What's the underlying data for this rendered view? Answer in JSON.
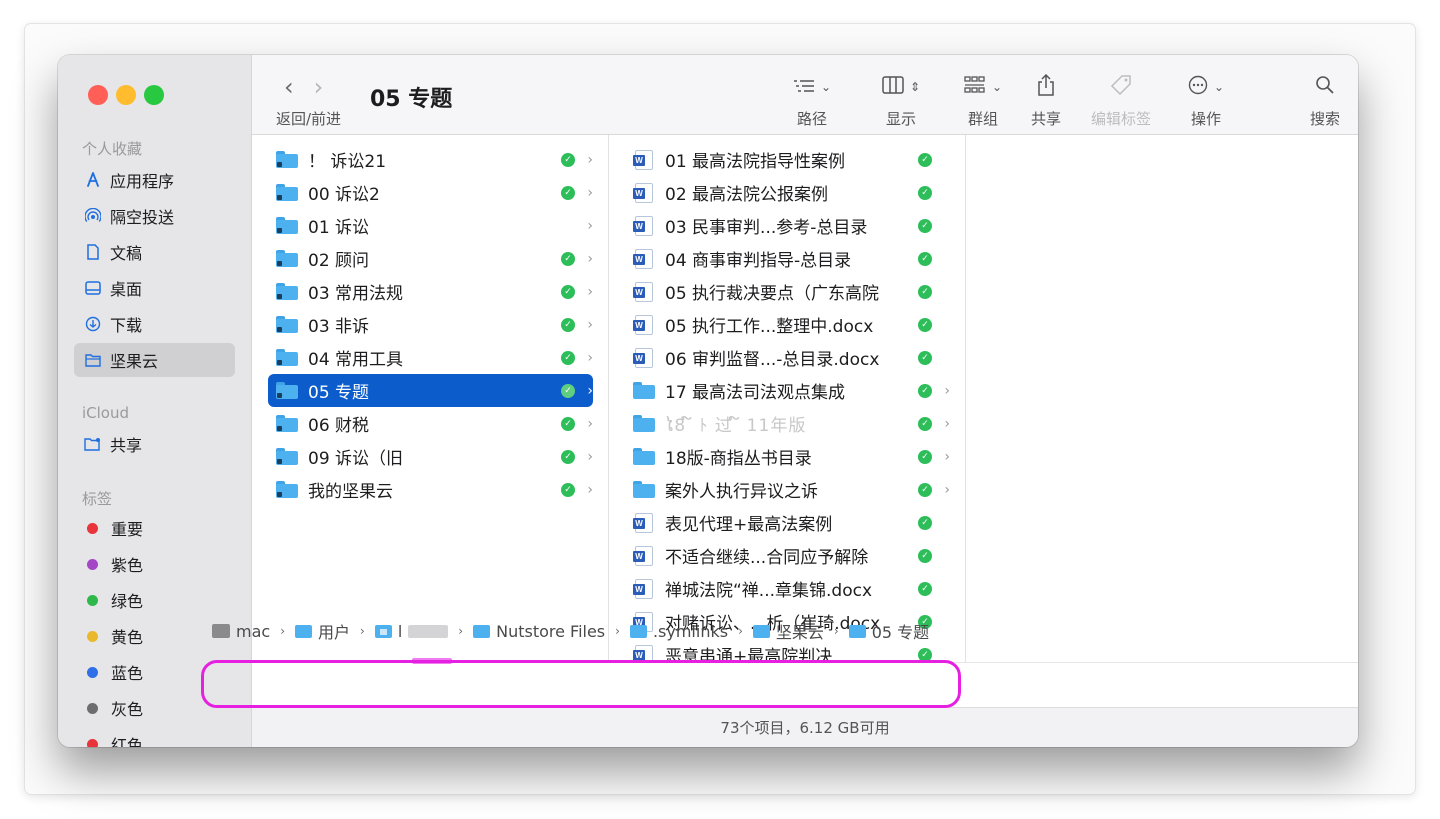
{
  "window": {
    "title": "05 专题",
    "nav_label": "返回/前进"
  },
  "toolbar": {
    "buttons": [
      {
        "label": "路径",
        "icon": "list-view-icon"
      },
      {
        "label": "显示",
        "icon": "column-view-icon"
      },
      {
        "label": "群组",
        "icon": "group-icon"
      },
      {
        "label": "共享",
        "icon": "share-icon"
      },
      {
        "label": "编辑标签",
        "icon": "tag-icon",
        "disabled": true
      },
      {
        "label": "操作",
        "icon": "more-icon"
      },
      {
        "label": "搜索",
        "icon": "search-icon"
      }
    ]
  },
  "sidebar": {
    "favorites_heading": "个人收藏",
    "favorites": [
      {
        "label": "应用程序",
        "icon": "applications-icon"
      },
      {
        "label": "隔空投送",
        "icon": "airdrop-icon"
      },
      {
        "label": "文稿",
        "icon": "document-icon"
      },
      {
        "label": "桌面",
        "icon": "desktop-icon"
      },
      {
        "label": "下载",
        "icon": "download-icon"
      },
      {
        "label": "坚果云",
        "icon": "folder-icon",
        "selected": true
      }
    ],
    "icloud_heading": "iCloud",
    "icloud": [
      {
        "label": "共享",
        "icon": "shared-folder-icon"
      }
    ],
    "tags_heading": "标签",
    "tags": [
      {
        "label": "重要",
        "color": "#e8343a"
      },
      {
        "label": "紫色",
        "color": "#a447c6"
      },
      {
        "label": "绿色",
        "color": "#2fb84a"
      },
      {
        "label": "黄色",
        "color": "#e9b82c"
      },
      {
        "label": "蓝色",
        "color": "#2f6fe8"
      },
      {
        "label": "灰色",
        "color": "#6d6d6f"
      },
      {
        "label": "红色",
        "color": "#e8343a"
      }
    ]
  },
  "column1": [
    {
      "name": "！ 诉讼21",
      "synced": true,
      "arrow": true
    },
    {
      "name": "00 诉讼2",
      "synced": true,
      "arrow": true
    },
    {
      "name": "01 诉讼",
      "synced": false,
      "arrow": true
    },
    {
      "name": "02 顾问",
      "synced": true,
      "arrow": true
    },
    {
      "name": "03 常用法规",
      "synced": true,
      "arrow": true
    },
    {
      "name": "03 非诉",
      "synced": true,
      "arrow": true
    },
    {
      "name": "04 常用工具",
      "synced": true,
      "arrow": true
    },
    {
      "name": "05 专题",
      "synced": true,
      "arrow": true,
      "selected": true
    },
    {
      "name": "06 财税",
      "synced": true,
      "arrow": true
    },
    {
      "name": "09 诉讼（旧",
      "synced": true,
      "arrow": true
    },
    {
      "name": "我的坚果云",
      "synced": true,
      "arrow": true
    }
  ],
  "column2": [
    {
      "name": "01 最高法院指导性案例",
      "type": "doc",
      "synced": true,
      "arrow": false
    },
    {
      "name": "02 最高法院公报案例",
      "type": "doc",
      "synced": true,
      "arrow": false
    },
    {
      "name": "03 民事审判...参考-总目录",
      "type": "doc",
      "synced": true,
      "arrow": false
    },
    {
      "name": "04 商事审判指导-总目录",
      "type": "doc",
      "synced": true,
      "arrow": false
    },
    {
      "name": "05 执行裁决要点（广东高院",
      "type": "doc",
      "synced": true,
      "arrow": false
    },
    {
      "name": "05 执行工作...整理中.docx",
      "type": "doc",
      "synced": true,
      "arrow": false
    },
    {
      "name": "06 审判监督...-总目录.docx",
      "type": "doc",
      "synced": true,
      "arrow": false
    },
    {
      "name": "17 最高法司法观点集成",
      "type": "folder",
      "synced": true,
      "arrow": true
    },
    {
      "name": "ໄ8 ໌ ﾄ 过 ໌ 11年版",
      "type": "folder",
      "synced": true,
      "arrow": true,
      "obscured": true
    },
    {
      "name": "18版-商指丛书目录",
      "type": "folder",
      "synced": true,
      "arrow": true
    },
    {
      "name": "案外人执行异议之诉",
      "type": "folder",
      "synced": true,
      "arrow": true
    },
    {
      "name": "表见代理+最高法案例",
      "type": "doc",
      "synced": true,
      "arrow": false
    },
    {
      "name": "不适合继续...合同应予解除",
      "type": "doc",
      "synced": true,
      "arrow": false
    },
    {
      "name": "禅城法院“禅...章集锦.docx",
      "type": "doc",
      "synced": true,
      "arrow": false
    },
    {
      "name": "对赌诉讼、...析（崔琦.docx",
      "type": "doc",
      "synced": true,
      "arrow": false
    },
    {
      "name": "恶意串通+最高院判决",
      "type": "doc",
      "synced": true,
      "arrow": false
    }
  ],
  "pathbar": {
    "items": [
      {
        "label": "mac",
        "icon": "disk-icon"
      },
      {
        "label": "用户",
        "icon": "folder-icon"
      },
      {
        "label": "l",
        "icon": "home-folder-icon",
        "obscured": true
      },
      {
        "label": "Nutstore Files",
        "icon": "folder-icon"
      },
      {
        "label": ".symlinks",
        "icon": "folder-icon"
      },
      {
        "label": "坚果云",
        "icon": "folder-icon"
      },
      {
        "label": "05 专题",
        "icon": "folder-icon"
      }
    ],
    "highlight_color": "#e620e0"
  },
  "statusbar": {
    "text": "73个项目，6.12 GB可用"
  }
}
